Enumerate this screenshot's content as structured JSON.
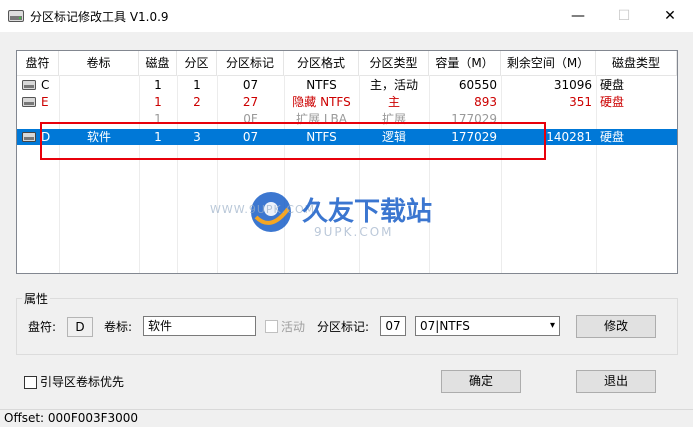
{
  "window": {
    "title": "分区标记修改工具 V1.0.9",
    "minimize": "—",
    "maximize": "☐",
    "close": "✕"
  },
  "table": {
    "columns": [
      "盘符",
      "卷标",
      "磁盘",
      "分区",
      "分区标记",
      "分区格式",
      "分区类型",
      "容量（M）",
      "剩余空间（M）",
      "磁盘类型"
    ],
    "rows": [
      {
        "drive": "C",
        "label": "",
        "disk": "1",
        "part": "1",
        "mark": "07",
        "format": "NTFS",
        "type": "主，活动",
        "size": "60550",
        "free": "31096",
        "disktype": "硬盘",
        "color": "#000000",
        "icon": "disk-icon"
      },
      {
        "drive": "E",
        "label": "",
        "disk": "1",
        "part": "2",
        "mark": "27",
        "format": "隐藏 NTFS",
        "type": "主",
        "size": "893",
        "free": "351",
        "disktype": "硬盘",
        "color": "#cc0000",
        "icon": "disk-icon"
      },
      {
        "drive": "",
        "label": "",
        "disk": "1",
        "part": "",
        "mark": "0F",
        "format": "扩展 LBA",
        "type": "扩展",
        "size": "177029",
        "free": "",
        "disktype": "",
        "color": "#9a9a9a",
        "icon": ""
      },
      {
        "drive": "D",
        "label": "软件",
        "disk": "1",
        "part": "3",
        "mark": "07",
        "format": "NTFS",
        "type": "逻辑",
        "size": "177029",
        "free": "140281",
        "disktype": "硬盘",
        "color": "#ffffff",
        "icon": "disk-icon",
        "selected": true
      }
    ]
  },
  "watermark": {
    "brand": "久友下载站",
    "url_left": "WWW.9UPK.COM",
    "url_right": "9UPK.COM"
  },
  "properties": {
    "group_label": "属性",
    "drive_label": "盘符:",
    "drive_value": "D",
    "volume_label": "卷标:",
    "volume_value": "软件",
    "active_label": "活动",
    "mark_label": "分区标记:",
    "mark_value": "07",
    "format_selected": "07|NTFS",
    "modify_button": "修改"
  },
  "footer": {
    "boot_priority_label": "引导区卷标优先",
    "ok_button": "确定",
    "exit_button": "退出"
  },
  "status": {
    "offset": "Offset: 000F003F3000"
  },
  "colors": {
    "selection": "#0078d7",
    "highlight_box": "#e8000b",
    "hidden_row": "#cc0000"
  }
}
